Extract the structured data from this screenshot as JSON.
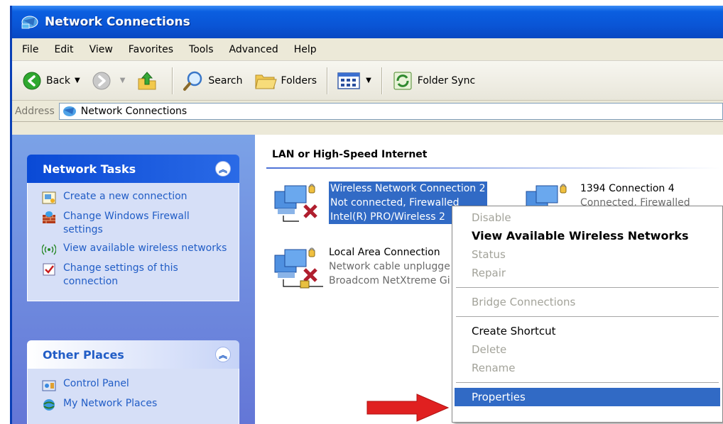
{
  "window": {
    "title": "Network Connections"
  },
  "menu": [
    "File",
    "Edit",
    "View",
    "Favorites",
    "Tools",
    "Advanced",
    "Help"
  ],
  "toolbar": {
    "back": "Back",
    "search": "Search",
    "folders": "Folders",
    "folder_sync": "Folder Sync"
  },
  "address": {
    "label": "Address",
    "value": "Network Connections"
  },
  "network_tasks": {
    "title": "Network Tasks",
    "items": [
      {
        "label": "Create a new connection",
        "icon": "new-connection-icon"
      },
      {
        "label": "Change Windows Firewall settings",
        "icon": "firewall-icon"
      },
      {
        "label": "View available wireless networks",
        "icon": "wireless-icon"
      },
      {
        "label": "Change settings of this connection",
        "icon": "settings-icon"
      }
    ]
  },
  "other_places": {
    "title": "Other Places",
    "items": [
      {
        "label": "Control Panel",
        "icon": "control-panel-icon"
      },
      {
        "label": "My Network Places",
        "icon": "network-places-icon"
      }
    ]
  },
  "group": {
    "title": "LAN or High-Speed Internet"
  },
  "connections": [
    {
      "name": "Wireless Network Connection 2",
      "status": "Not connected, Firewalled",
      "device": "Intel(R) PRO/Wireless 2",
      "selected": true
    },
    {
      "name": "1394 Connection 4",
      "status": "Connected, Firewalled"
    },
    {
      "name": "Local Area Connection",
      "status": "Network cable unplugge",
      "device": "Broadcom NetXtreme Gi"
    }
  ],
  "context_menu": {
    "disable": "Disable",
    "view_wireless": "View Available Wireless Networks",
    "status": "Status",
    "repair": "Repair",
    "bridge": "Bridge Connections",
    "create_shortcut": "Create Shortcut",
    "delete": "Delete",
    "rename": "Rename",
    "properties": "Properties"
  },
  "colors": {
    "titlebar": "#0a55d6",
    "selection": "#316ac5",
    "arrow": "#e02020",
    "taskpane": "#7ba2e7"
  }
}
